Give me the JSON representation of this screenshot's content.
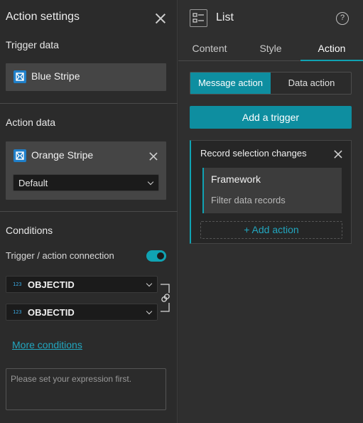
{
  "left": {
    "title": "Action settings",
    "trigger": {
      "label": "Trigger data",
      "source": "Blue Stripe"
    },
    "action": {
      "label": "Action data",
      "source": "Orange Stripe",
      "view": "Default"
    },
    "conditions": {
      "label": "Conditions",
      "connection_label": "Trigger / action connection",
      "connection_enabled": true,
      "trigger_field": {
        "type": "123",
        "name": "OBJECTID"
      },
      "action_field": {
        "type": "123",
        "name": "OBJECTID"
      },
      "more_link": "More conditions",
      "expression_placeholder": "Please set your expression first."
    }
  },
  "right": {
    "widget_title": "List",
    "help": "?",
    "tabs": [
      "Content",
      "Style",
      "Action"
    ],
    "active_tab": "Action",
    "action_types": [
      "Message action",
      "Data action"
    ],
    "active_action_type": "Message action",
    "add_trigger_label": "Add a trigger",
    "trigger_card": {
      "title": "Record selection changes",
      "target_title": "Framework",
      "target_action": "Filter data records",
      "add_action_label": "+ Add action"
    }
  },
  "colors": {
    "accent": "#10a3b3",
    "accent_button": "#0e8ea0",
    "link": "#22a6bf",
    "datasource_icon": "#1f7fc9"
  }
}
